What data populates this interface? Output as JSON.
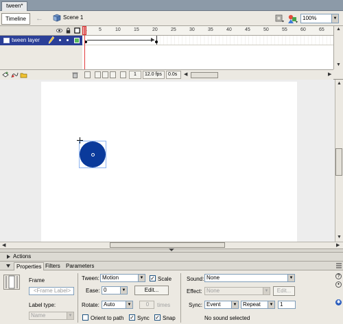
{
  "document": {
    "tab_label": "tween*"
  },
  "toolbar": {
    "timeline_tab": "Timeline",
    "scene_label": "Scene 1",
    "zoom": "100%"
  },
  "timeline": {
    "layer_name": "tween layer",
    "ruler_labels": [
      "1",
      "5",
      "10",
      "15",
      "20",
      "25",
      "30",
      "35",
      "40",
      "45",
      "50",
      "55",
      "60",
      "65"
    ],
    "current_frame": "1",
    "fps": "12.0 fps",
    "elapsed": "0.0s"
  },
  "panels": {
    "actions_label": "Actions",
    "tabs": [
      "Properties",
      "Filters",
      "Parameters"
    ]
  },
  "properties": {
    "frame_label": "Frame",
    "frame_placeholder": "<Frame Label>",
    "label_type_label": "Label type:",
    "label_type_value": "Name",
    "tween_label": "Tween:",
    "tween_value": "Motion",
    "scale_label": "Scale",
    "scale_checked": true,
    "ease_label": "Ease:",
    "ease_value": "0",
    "edit_label": "Edit...",
    "rotate_label": "Rotate:",
    "rotate_value": "Auto",
    "times_value": "0",
    "times_label": "times",
    "orient_label": "Orient to path",
    "orient_checked": false,
    "sync_label": "Sync",
    "sync_checked": true,
    "snap_label": "Snap",
    "snap_checked": true,
    "sound_label": "Sound:",
    "sound_value": "None",
    "effect_label": "Effect:",
    "effect_value": "None",
    "effect_edit_label": "Edit...",
    "sync_select_label": "Sync:",
    "sync_value": "Event",
    "repeat_value": "Repeat",
    "repeat_count": "1",
    "no_sound": "No sound selected"
  },
  "colors": {
    "layer_selected": "#2b3f97",
    "shape_fill": "#0a3a9b",
    "playhead": "#e23a3a"
  }
}
